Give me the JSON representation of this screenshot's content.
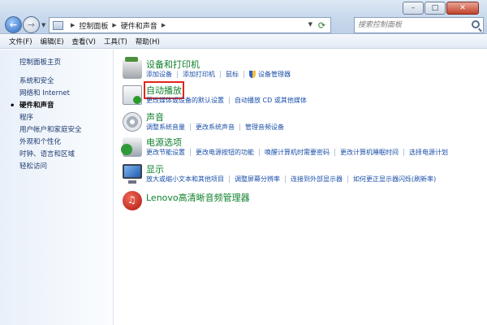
{
  "window": {
    "minimize_glyph": "–",
    "maximize_glyph": "□",
    "close_glyph": "✕"
  },
  "nav": {
    "back_glyph": "←",
    "forward_glyph": "→",
    "breadcrumbs": [
      "控制面板",
      "硬件和声音"
    ],
    "search_placeholder": "搜索控制面板"
  },
  "menu": [
    "文件(F)",
    "编辑(E)",
    "查看(V)",
    "工具(T)",
    "帮助(H)"
  ],
  "sidebar": {
    "home": "控制面板主页",
    "items": [
      {
        "label": "系统和安全",
        "current": false
      },
      {
        "label": "网络和 Internet",
        "current": false
      },
      {
        "label": "硬件和声音",
        "current": true
      },
      {
        "label": "程序",
        "current": false
      },
      {
        "label": "用户帐户和家庭安全",
        "current": false
      },
      {
        "label": "外观和个性化",
        "current": false
      },
      {
        "label": "时钟、语言和区域",
        "current": false
      },
      {
        "label": "轻松访问",
        "current": false
      }
    ]
  },
  "categories": [
    {
      "icon": "printer-icon",
      "title": "设备和打印机",
      "links": [
        "添加设备",
        "添加打印机",
        "鼠标",
        "设备管理器"
      ]
    },
    {
      "icon": "autoplay-icon",
      "title": "自动播放",
      "highlighted": true,
      "links": [
        "更改媒体或设备的默认设置",
        "自动播放 CD 或其他媒体"
      ]
    },
    {
      "icon": "speaker-icon",
      "title": "声音",
      "links": [
        "调整系统音量",
        "更改系统声音",
        "管理音频设备"
      ]
    },
    {
      "icon": "power-icon",
      "title": "电源选项",
      "links": [
        "更改节能设置",
        "更改电源按钮的功能",
        "唤醒计算机时需要密码",
        "更改计算机睡眠时间",
        "选择电源计划"
      ]
    },
    {
      "icon": "display-icon",
      "title": "显示",
      "links": [
        "放大或缩小文本和其他项目",
        "调整屏幕分辨率",
        "连接到外部显示器",
        "如何更正显示器闪烁(刷新率)"
      ]
    },
    {
      "icon": "lenovo-audio-icon",
      "title": "Lenovo高清晰音频管理器",
      "links": []
    }
  ],
  "colors": {
    "category_title": "#0e7f2b",
    "link": "#1a4fa8",
    "highlight_box": "#e0251c"
  }
}
